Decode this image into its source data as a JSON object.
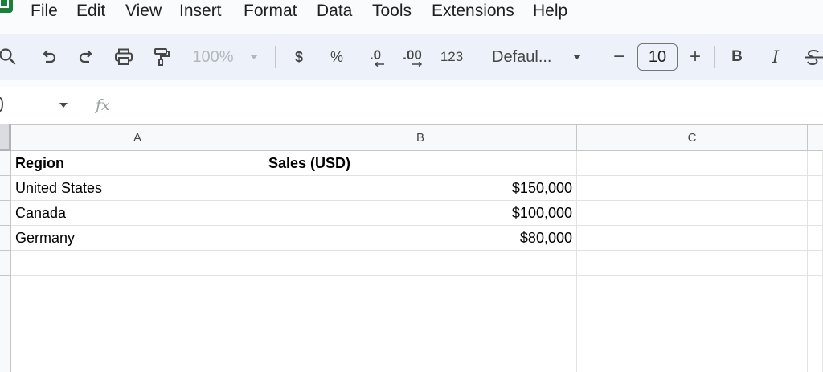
{
  "menu": [
    "File",
    "Edit",
    "View",
    "Insert",
    "Format",
    "Data",
    "Tools",
    "Extensions",
    "Help"
  ],
  "toolbar": {
    "zoom": "100%",
    "currency": "$",
    "percent": "%",
    "decrease_decimal": ".0",
    "increase_decimal": ".00",
    "number_format": "123",
    "font": "Defaul...",
    "font_size_decrease": "−",
    "font_size": "10",
    "font_size_increase": "+",
    "bold": "B",
    "italic": "I"
  },
  "formula_bar": {
    "fx": "fx"
  },
  "columns": [
    "A",
    "B",
    "C"
  ],
  "rows": [
    [
      "Region",
      "Sales (USD)",
      ""
    ],
    [
      "United States",
      "$150,000",
      ""
    ],
    [
      "Canada",
      "$100,000",
      ""
    ],
    [
      "Germany",
      "$80,000",
      ""
    ],
    [
      "",
      "",
      ""
    ],
    [
      "",
      "",
      ""
    ],
    [
      "",
      "",
      ""
    ],
    [
      "",
      "",
      ""
    ],
    [
      "",
      "",
      ""
    ]
  ],
  "colors": {
    "accent_green": "#188038",
    "toolbar_bg": "#edf2fa",
    "grid_line": "#e1e3e1"
  }
}
